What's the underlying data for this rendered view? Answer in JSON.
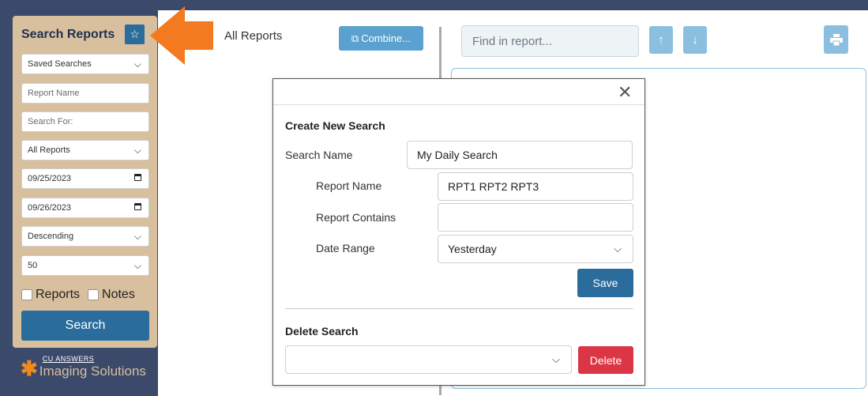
{
  "sidebar": {
    "title": "Search Reports",
    "favorite_icon": "star-icon",
    "saved_searches": "Saved Searches",
    "report_name_placeholder": "Report Name",
    "search_for_placeholder": "Search For:",
    "report_type": "All Reports",
    "date_from": "09/25/2023",
    "date_to": "09/26/2023",
    "sort_order": "Descending",
    "page_size": "50",
    "check_reports": "Reports",
    "check_notes": "Notes",
    "search_label": "Search",
    "logo_small": "CU ANSWERS",
    "logo_main": "Imaging Solutions"
  },
  "middle": {
    "all_reports": "All Reports",
    "combine_label": "Combine..."
  },
  "viewer": {
    "find_placeholder": "Find in report...",
    "up_icon": "arrow-up-icon",
    "down_icon": "arrow-down-icon",
    "print_icon": "printer-icon"
  },
  "modal": {
    "close_icon": "close-icon",
    "create_heading": "Create New Search",
    "search_name_label": "Search Name",
    "search_name_value": "My Daily Search",
    "report_name_label": "Report Name",
    "report_name_value": "RPT1 RPT2 RPT3",
    "report_contains_label": "Report Contains",
    "report_contains_value": "",
    "date_range_label": "Date Range",
    "date_range_value": "Yesterday",
    "save_label": "Save",
    "delete_heading": "Delete Search",
    "delete_select_value": "",
    "delete_label": "Delete"
  },
  "colors": {
    "accent": "#2a6d9c",
    "light_accent": "#8bbfe0",
    "sidebar_bg": "#d8bf9e",
    "header_bg": "#3b4a6b",
    "danger": "#dc3545",
    "annotation_arrow": "#f47a20"
  }
}
